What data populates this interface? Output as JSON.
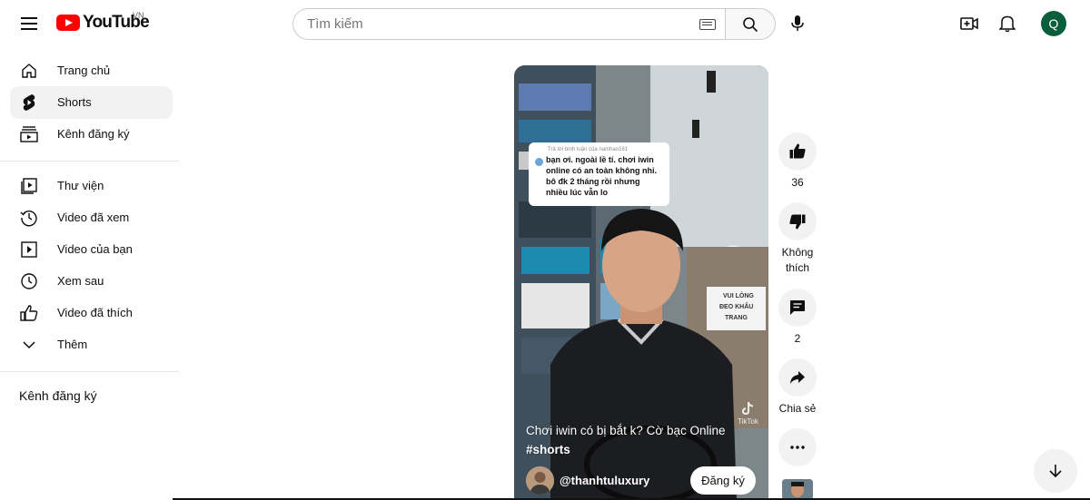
{
  "header": {
    "logo_text": "YouTube",
    "region": "VN",
    "search_placeholder": "Tìm kiếm",
    "avatar_letter": "Q"
  },
  "sidebar": {
    "items": [
      {
        "label": "Trang chủ",
        "icon": "home-icon"
      },
      {
        "label": "Shorts",
        "icon": "shorts-icon",
        "active": true
      },
      {
        "label": "Kênh đăng ký",
        "icon": "subscriptions-icon"
      }
    ],
    "library": [
      {
        "label": "Thư viện",
        "icon": "library-icon"
      },
      {
        "label": "Video đã xem",
        "icon": "history-icon"
      },
      {
        "label": "Video của bạn",
        "icon": "your-videos-icon"
      },
      {
        "label": "Xem sau",
        "icon": "watch-later-icon"
      },
      {
        "label": "Video đã thích",
        "icon": "liked-videos-icon"
      },
      {
        "label": "Thêm",
        "icon": "chevron-down-icon"
      }
    ],
    "section_title": "Kênh đăng ký"
  },
  "short": {
    "comment_header": "Trả lời bình luận của namhao181",
    "comment_text": "bạn ơi. ngoài lề tí. chơi iwin online có an toàn không nhỉ. bô đk 2 tháng rồi nhưng nhiều lúc vẫn lo",
    "title": "Chơi iwin có bị bắt k? Cờ bạc Online",
    "hashtag": "#shorts",
    "channel": "@thanhtuluxury",
    "subscribe_label": "Đăng ký",
    "watermark": "TikTok",
    "sign_text": "VUI LÒNG ĐEO KHẨU TRANG"
  },
  "actions": {
    "like_count": "36",
    "dislike_label": "Không thích",
    "comment_count": "2",
    "share_label": "Chia sẻ"
  },
  "colors": {
    "brand_red": "#ff0000",
    "avatar_bg": "#0b5e3c",
    "active_bg": "#f2f2f2"
  }
}
